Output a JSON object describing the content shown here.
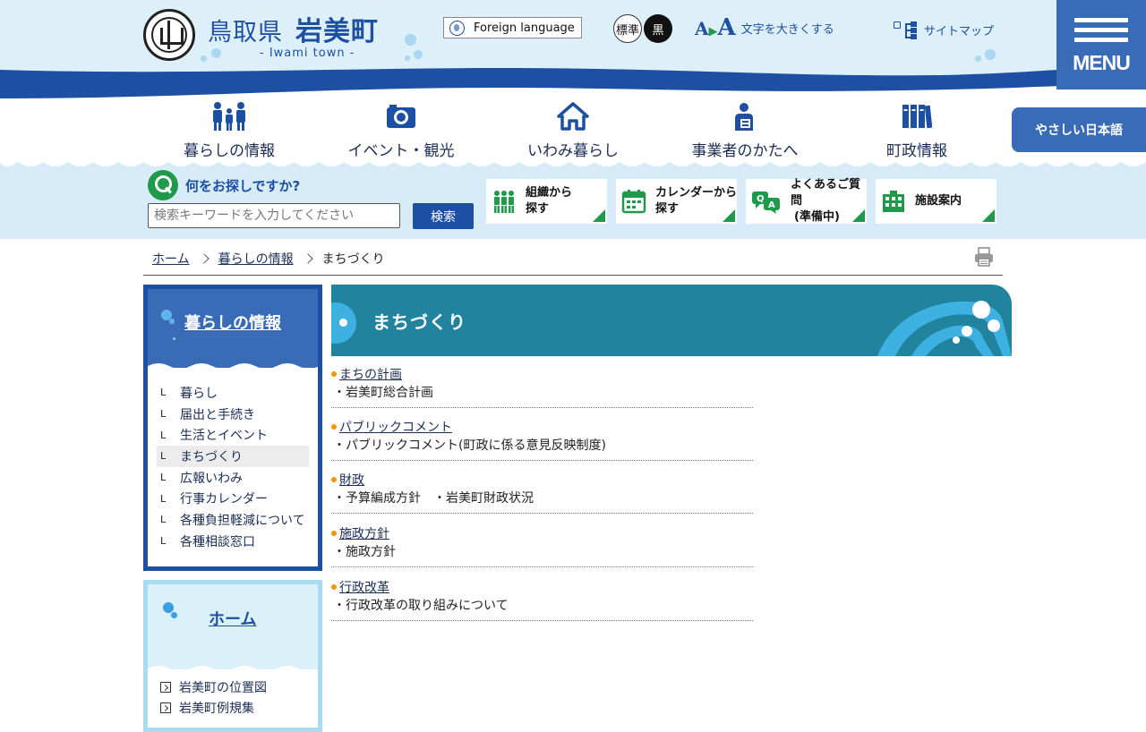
{
  "header": {
    "logo_pref": "鳥取県",
    "logo_town": "岩美町",
    "logo_sub": "- Iwami town -",
    "foreign_language": "Foreign language",
    "contrast_standard": "標準",
    "contrast_black": "黒",
    "font_size_label": "文字を大きくする",
    "sitemap_label": "サイトマップ",
    "menu_label": "MENU"
  },
  "gnav": {
    "items": [
      {
        "label": "暮らしの情報",
        "icon": "family-icon"
      },
      {
        "label": "イベント・観光",
        "icon": "camera-icon"
      },
      {
        "label": "いわみ暮らし",
        "icon": "house-icon"
      },
      {
        "label": "事業者のかたへ",
        "icon": "worker-icon"
      },
      {
        "label": "町政情報",
        "icon": "books-icon"
      }
    ],
    "easy_japanese": "やさしい日本語"
  },
  "search": {
    "title": "何をお探しですか?",
    "placeholder": "検索キーワードを入力してください",
    "button": "検索",
    "quick_links": [
      {
        "line1": "組織から",
        "line2": "探す",
        "icon": "organization-icon"
      },
      {
        "line1": "カレンダーから",
        "line2": "探す",
        "icon": "calendar-icon"
      },
      {
        "line1": "よくあるご質問",
        "line2": "(準備中)",
        "icon": "qa-icon"
      },
      {
        "line1": "施設案内",
        "line2": "",
        "icon": "building-icon"
      }
    ]
  },
  "breadcrumb": {
    "home": "ホーム",
    "parent": "暮らしの情報",
    "current": "まちづくり"
  },
  "sidebar": {
    "title": "暮らしの情報",
    "items": [
      {
        "label": "暮らし"
      },
      {
        "label": "届出と手続き"
      },
      {
        "label": "生活とイベント"
      },
      {
        "label": "まちづくり"
      },
      {
        "label": "広報いわみ"
      },
      {
        "label": "行事カレンダー"
      },
      {
        "label": "各種負担軽減について"
      },
      {
        "label": "各種相談窓口"
      }
    ],
    "home_title": "ホーム",
    "home_items": [
      {
        "label": "岩美町の位置図"
      },
      {
        "label": "岩美町例規集"
      }
    ]
  },
  "main": {
    "title": "まちづくり",
    "sections": [
      {
        "heading": "まちの計画",
        "text": "・岩美町総合計画"
      },
      {
        "heading": "パブリックコメント",
        "text": "・パブリックコメント(町政に係る意見反映制度)"
      },
      {
        "heading": "財政",
        "text": "・予算編成方針　・岩美町財政状況"
      },
      {
        "heading": "施政方針",
        "text": "・施政方針"
      },
      {
        "heading": "行政改革",
        "text": "・行政改革の取り組みについて"
      }
    ]
  },
  "colors": {
    "brand_blue": "#1d4fa2",
    "accent_teal": "#21839e",
    "accent_green": "#1f9a4b",
    "bullet_orange": "#f29600"
  }
}
